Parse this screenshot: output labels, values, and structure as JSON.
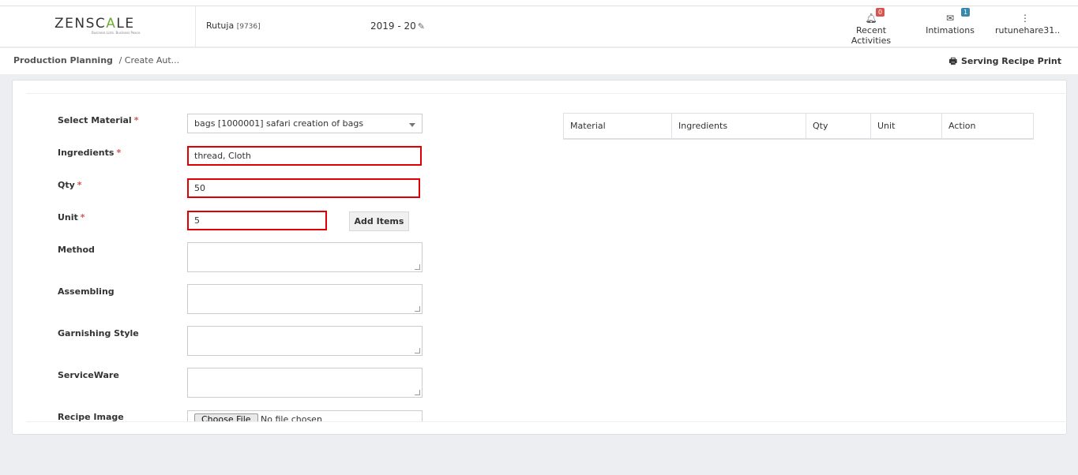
{
  "header": {
    "logo_pre": "ZENSC",
    "logo_mid": "A",
    "logo_post": "LE",
    "logo_tagline": "Business Lists. Business Peace.",
    "user_name": "Rutuja",
    "user_id": "[9736]",
    "financial_year": "2019 - 20",
    "recent_activities": {
      "label": "Recent Activities",
      "count": "0"
    },
    "intimations": {
      "label": "Intimations",
      "count": "1"
    },
    "account": {
      "label": "rutunehare31.."
    }
  },
  "breadcrumb": {
    "root": "Production Planning",
    "current": "/ Create Aut..."
  },
  "actions": {
    "print_label": "Serving Recipe Print"
  },
  "form": {
    "material_label": "Select Material",
    "material_value": "bags [1000001] safari creation of bags",
    "ingredients_label": "Ingredients",
    "ingredients_value": "thread,  Cloth",
    "qty_label": "Qty",
    "qty_value": "50",
    "unit_label": "Unit",
    "unit_value": "5",
    "add_items_label": "Add Items",
    "method_label": "Method",
    "assembling_label": "Assembling",
    "garnishing_label": "Garnishing Style",
    "serviceware_label": "ServiceWare",
    "recipe_image_label": "Recipe Image",
    "choose_file_label": "Choose File",
    "no_file_label": "No file chosen",
    "required_mark": "*"
  },
  "table": {
    "headers": [
      "Material",
      "Ingredients",
      "Qty",
      "Unit",
      "Action"
    ]
  },
  "colors": {
    "accent": "#6cae2f",
    "error_border": "#e00000",
    "required": "#d9534f"
  }
}
